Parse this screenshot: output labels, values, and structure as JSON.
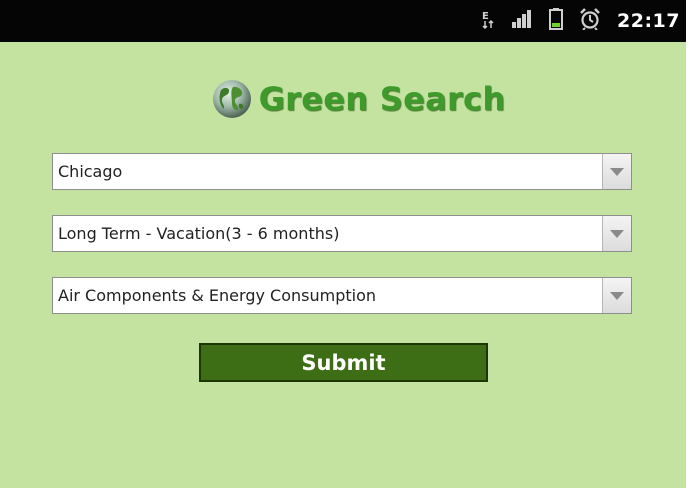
{
  "status_bar": {
    "time": "22:17",
    "icons": [
      "data-transfer-icon",
      "signal-icon",
      "battery-icon",
      "alarm-icon"
    ]
  },
  "app": {
    "title": "Green Search",
    "logo_icon": "globe-icon"
  },
  "form": {
    "city_select": {
      "selected": "Chicago"
    },
    "duration_select": {
      "selected": "Long Term - Vacation(3 - 6 months)"
    },
    "category_select": {
      "selected": "Air Components & Energy Consumption"
    },
    "submit_label": "Submit"
  },
  "colors": {
    "background": "#c4e3a1",
    "title": "#3f9a2c",
    "button": "#3d6d14",
    "status_bar": "#050505"
  }
}
